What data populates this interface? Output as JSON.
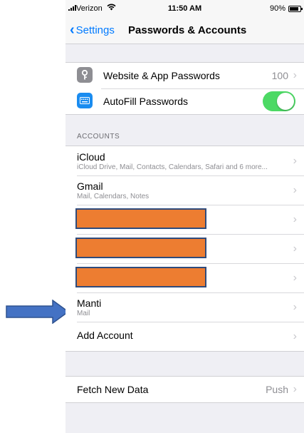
{
  "status": {
    "carrier": "Verizon",
    "wifi_icon": "wifi-icon",
    "time": "11:50 AM",
    "battery": "90%"
  },
  "nav": {
    "back_label": "Settings",
    "title": "Passwords & Accounts"
  },
  "passwords": {
    "website_label": "Website & App Passwords",
    "website_count": "100",
    "autofill_label": "AutoFill Passwords",
    "autofill_on": true
  },
  "accounts_header": "ACCOUNTS",
  "accounts": [
    {
      "name": "iCloud",
      "detail": "iCloud Drive, Mail, Contacts, Calendars, Safari and 6 more..."
    },
    {
      "name": "Gmail",
      "detail": "Mail, Calendars, Notes"
    },
    {
      "redacted": true
    },
    {
      "redacted": true
    },
    {
      "redacted": true
    },
    {
      "name": "Manti",
      "detail": "Mail"
    }
  ],
  "add_account_label": "Add Account",
  "fetch": {
    "label": "Fetch New Data",
    "value": "Push"
  },
  "colors": {
    "accent": "#007aff",
    "toggle_on": "#4cd964",
    "redaction_fill": "#ed7d31",
    "redaction_border": "#2f4b7c",
    "arrow": "#4472c4"
  }
}
